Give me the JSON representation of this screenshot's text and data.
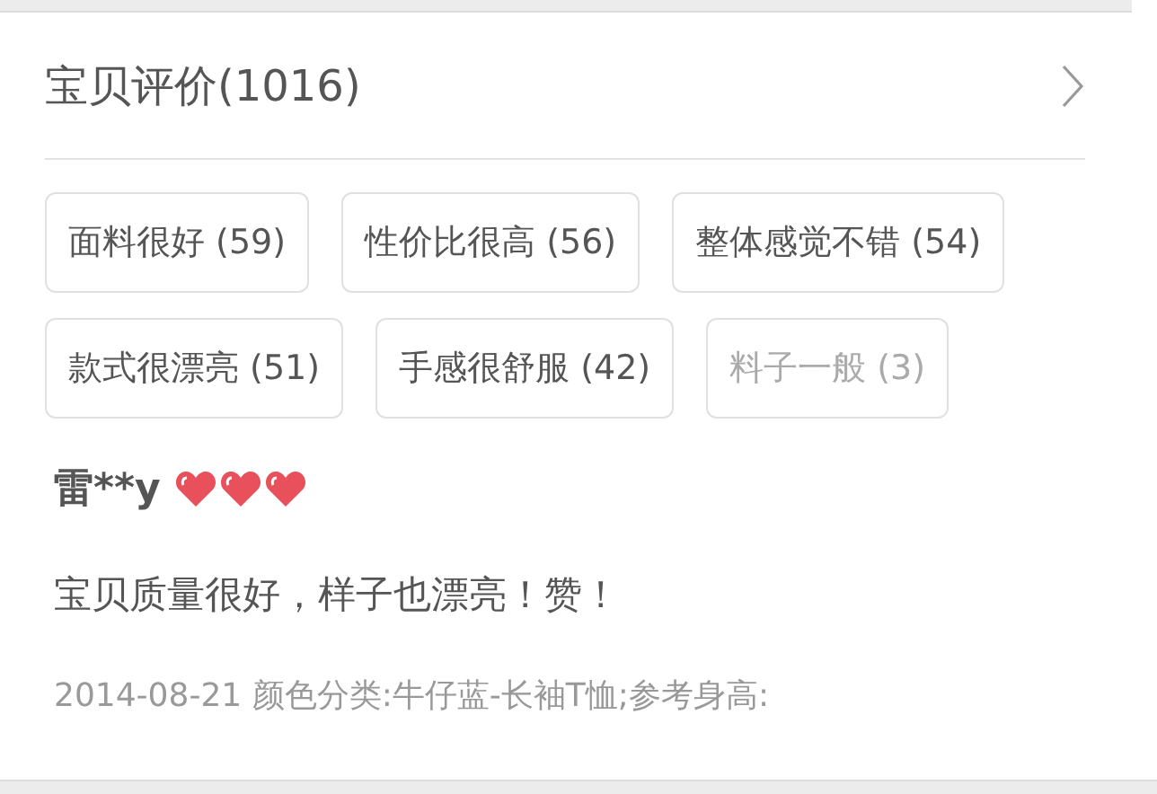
{
  "header": {
    "title": "宝贝评价(1016)"
  },
  "tags": [
    {
      "label": "面料很好 (59)",
      "muted": false
    },
    {
      "label": "性价比很高 (56)",
      "muted": false
    },
    {
      "label": "整体感觉不错 (54)",
      "muted": false
    },
    {
      "label": "款式很漂亮 (51)",
      "muted": false
    },
    {
      "label": "手感很舒服 (42)",
      "muted": false
    },
    {
      "label": "料子一般 (3)",
      "muted": true
    }
  ],
  "review": {
    "user": "雷**y",
    "stars": 3,
    "text": "宝贝质量很好，样子也漂亮！赞！",
    "meta": "2014-08-21 颜色分类:牛仔蓝-长袖T恤;参考身高:"
  }
}
